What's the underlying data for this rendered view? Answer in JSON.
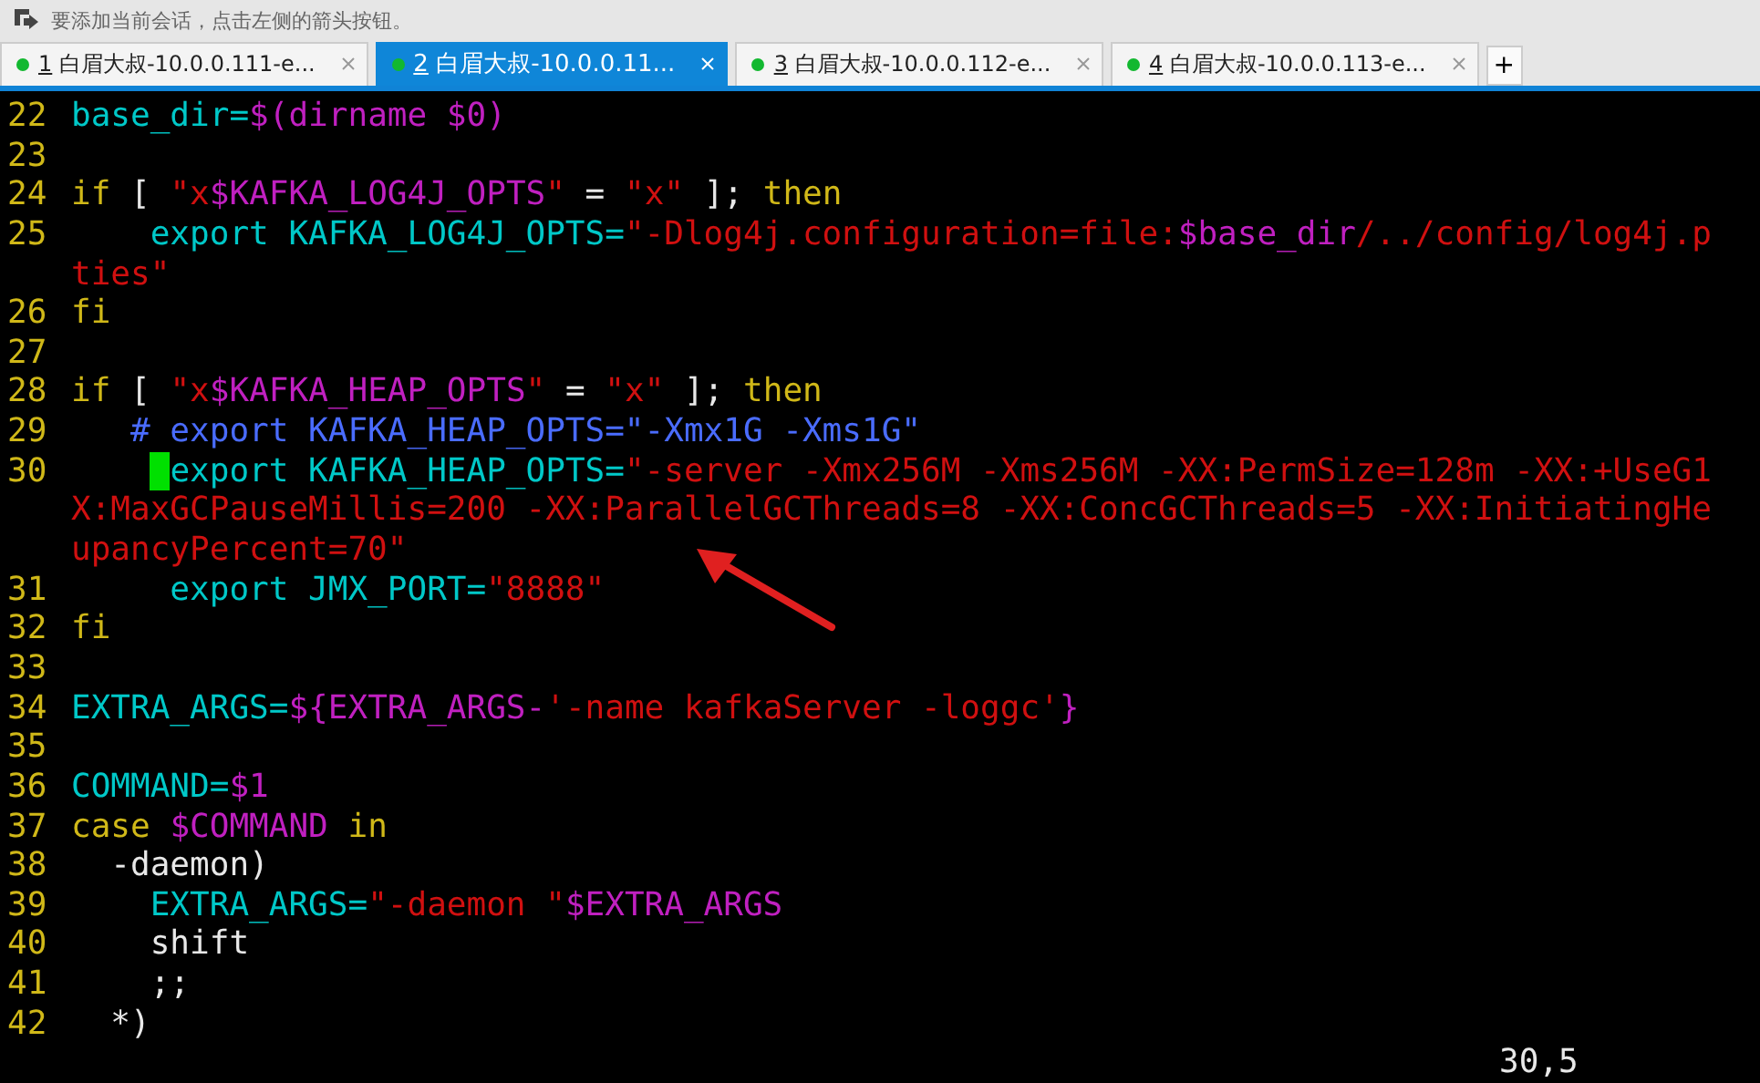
{
  "toolbar": {
    "hint": "要添加当前会话，点击左侧的箭头按钮。"
  },
  "tabs": [
    {
      "key": "1",
      "label": " 白眉大叔-10.0.0.111-e...",
      "selected": false
    },
    {
      "key": "2",
      "label": " 白眉大叔-10.0.0.11...",
      "selected": true
    },
    {
      "key": "3",
      "label": " 白眉大叔-10.0.0.112-e...",
      "selected": false
    },
    {
      "key": "4",
      "label": " 白眉大叔-10.0.0.113-e...",
      "selected": false
    }
  ],
  "new_tab": "+",
  "terminal": {
    "lines": [
      {
        "num": "22",
        "segments": [
          {
            "kind": "var",
            "text": "base_dir="
          },
          {
            "kind": "sub",
            "text": "$(dirname $0)"
          }
        ]
      },
      {
        "num": "23"
      },
      {
        "num": "24",
        "segments": [
          {
            "kind": "kw",
            "text": "if"
          },
          {
            "kind": "text",
            "text": " [ "
          },
          {
            "kind": "str",
            "text": "\"x"
          },
          {
            "kind": "sub",
            "text": "$KAFKA_LOG4J_OPTS"
          },
          {
            "kind": "str",
            "text": "\""
          },
          {
            "kind": "text",
            "text": " = "
          },
          {
            "kind": "str",
            "text": "\"x\""
          },
          {
            "kind": "text",
            "text": " ]; "
          },
          {
            "kind": "kw",
            "text": "then"
          }
        ]
      },
      {
        "num": "25",
        "segments": [
          {
            "kind": "var",
            "text": "    export KAFKA_LOG4J_OPTS="
          },
          {
            "kind": "str",
            "text": "\"-Dlog4j.configuration=file:"
          },
          {
            "kind": "sub",
            "text": "$base_dir"
          },
          {
            "kind": "str",
            "text": "/../config/log4j.p"
          }
        ]
      },
      {
        "segments": [
          {
            "kind": "str",
            "text": "ties\""
          }
        ]
      },
      {
        "num": "26",
        "segments": [
          {
            "kind": "kw",
            "text": "fi"
          }
        ]
      },
      {
        "num": "27"
      },
      {
        "num": "28",
        "segments": [
          {
            "kind": "kw",
            "text": "if"
          },
          {
            "kind": "text",
            "text": " [ "
          },
          {
            "kind": "str",
            "text": "\"x"
          },
          {
            "kind": "sub",
            "text": "$KAFKA_HEAP_OPTS"
          },
          {
            "kind": "str",
            "text": "\""
          },
          {
            "kind": "text",
            "text": " = "
          },
          {
            "kind": "str",
            "text": "\"x\""
          },
          {
            "kind": "text",
            "text": " ]; "
          },
          {
            "kind": "kw",
            "text": "then"
          }
        ]
      },
      {
        "num": "29",
        "segments": [
          {
            "kind": "comment",
            "text": "   # export KAFKA_HEAP_OPTS=\"-Xmx1G -Xms1G\""
          }
        ]
      },
      {
        "num": "30",
        "segments": [
          {
            "kind": "var",
            "text": "     export KAFKA_HEAP_OPTS=",
            "cursor": true
          },
          {
            "kind": "str",
            "text": "\"-server -Xmx256M -Xms256M -XX:PermSize=128m -XX:+UseG1"
          }
        ]
      },
      {
        "segments": [
          {
            "kind": "str",
            "text": "X:MaxGCPauseMillis=200 -XX:ParallelGCThreads=8 -XX:ConcGCThreads=5 -XX:InitiatingHe"
          }
        ]
      },
      {
        "segments": [
          {
            "kind": "str",
            "text": "upancyPercent=70\""
          }
        ]
      },
      {
        "num": "31",
        "segments": [
          {
            "kind": "var",
            "text": "     export JMX_PORT="
          },
          {
            "kind": "str",
            "text": "\"8888\""
          }
        ]
      },
      {
        "num": "32",
        "segments": [
          {
            "kind": "kw",
            "text": "fi"
          }
        ]
      },
      {
        "num": "33"
      },
      {
        "num": "34",
        "segments": [
          {
            "kind": "var",
            "text": "EXTRA_ARGS="
          },
          {
            "kind": "sub",
            "text": "${EXTRA_ARGS-"
          },
          {
            "kind": "str",
            "text": "'-name kafkaServer -loggc'"
          },
          {
            "kind": "sub",
            "text": "}"
          }
        ]
      },
      {
        "num": "35"
      },
      {
        "num": "36",
        "segments": [
          {
            "kind": "var",
            "text": "COMMAND="
          },
          {
            "kind": "sub",
            "text": "$1"
          }
        ]
      },
      {
        "num": "37",
        "segments": [
          {
            "kind": "kw",
            "text": "case "
          },
          {
            "kind": "sub",
            "text": "$COMMAND"
          },
          {
            "kind": "kw",
            "text": " in"
          }
        ]
      },
      {
        "num": "38",
        "segments": [
          {
            "kind": "text",
            "text": "  -daemon)"
          }
        ]
      },
      {
        "num": "39",
        "segments": [
          {
            "kind": "var",
            "text": "    EXTRA_ARGS="
          },
          {
            "kind": "str",
            "text": "\"-daemon \""
          },
          {
            "kind": "sub",
            "text": "$EXTRA_ARGS"
          }
        ]
      },
      {
        "num": "40",
        "segments": [
          {
            "kind": "text",
            "text": "    shift"
          }
        ]
      },
      {
        "num": "41",
        "segments": [
          {
            "kind": "text",
            "text": "    ;;"
          }
        ]
      },
      {
        "num": "42",
        "segments": [
          {
            "kind": "text",
            "text": "  *)"
          }
        ]
      }
    ],
    "status": "30,5"
  }
}
